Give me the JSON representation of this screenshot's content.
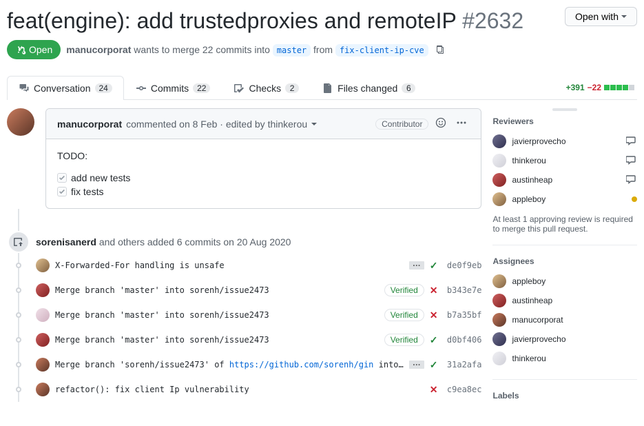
{
  "header": {
    "title": "feat(engine): add trustedproxies and remoteIP",
    "issue_number": "#2632",
    "open_with": "Open with"
  },
  "state": {
    "label": "Open",
    "author": "manucorporat",
    "wants": "wants to merge 22 commits into",
    "base": "master",
    "from": "from",
    "head": "fix-client-ip-cve"
  },
  "tabs": {
    "conversation": {
      "label": "Conversation",
      "count": "24"
    },
    "commits": {
      "label": "Commits",
      "count": "22"
    },
    "checks": {
      "label": "Checks",
      "count": "2"
    },
    "files": {
      "label": "Files changed",
      "count": "6"
    }
  },
  "diff": {
    "additions": "+391",
    "deletions": "−22"
  },
  "comment": {
    "author": "manucorporat",
    "meta": "commented on 8 Feb · edited by thinkerou",
    "badge": "Contributor",
    "todo_heading": "TODO:",
    "tasks": [
      "add new tests",
      "fix tests"
    ]
  },
  "commits_event": {
    "author": "sorenisanerd",
    "suffix": "and others added 6 commits",
    "date": "on 20 Aug 2020"
  },
  "commits": [
    {
      "avatar": "av-1",
      "msg": "X-Forwarded-For handling is unsafe",
      "ellipsis": true,
      "verified": false,
      "status": "ok",
      "sha": "de0f9eb"
    },
    {
      "avatar": "av-2",
      "msg": "Merge branch 'master' into sorenh/issue2473",
      "verified": true,
      "status": "x",
      "sha": "b343e7e"
    },
    {
      "avatar": "av-3",
      "msg": "Merge branch 'master' into sorenh/issue2473",
      "verified": true,
      "status": "x",
      "sha": "b7a35bf"
    },
    {
      "avatar": "av-2",
      "msg": "Merge branch 'master' into sorenh/issue2473",
      "verified": true,
      "status": "ok",
      "sha": "d0bf406"
    },
    {
      "avatar": "av-4",
      "msg_pre": "Merge branch 'sorenh/issue2473' of ",
      "link": "https://github.com/sorenh/gin",
      "msg_post": " into…",
      "ellipsis": true,
      "verified": false,
      "status": "ok",
      "sha": "31a2afa"
    },
    {
      "avatar": "av-4",
      "msg": "refactor(): fix client Ip vulnerability",
      "verified": false,
      "status": "x",
      "sha": "c9ea8ec"
    }
  ],
  "sidebar": {
    "reviewers_title": "Reviewers",
    "reviewers": [
      {
        "name": "javierprovecho",
        "avatar": "av-5",
        "action": "re-request"
      },
      {
        "name": "thinkerou",
        "avatar": "av-6",
        "action": "re-request"
      },
      {
        "name": "austinheap",
        "avatar": "av-2",
        "action": "re-request"
      },
      {
        "name": "appleboy",
        "avatar": "av-1",
        "action": "pending"
      }
    ],
    "review_note": "At least 1 approving review is required to merge this pull request.",
    "assignees_title": "Assignees",
    "assignees": [
      {
        "name": "appleboy",
        "avatar": "av-1"
      },
      {
        "name": "austinheap",
        "avatar": "av-2"
      },
      {
        "name": "manucorporat",
        "avatar": "av-4"
      },
      {
        "name": "javierprovecho",
        "avatar": "av-5"
      },
      {
        "name": "thinkerou",
        "avatar": "av-6"
      }
    ],
    "labels_title": "Labels"
  }
}
